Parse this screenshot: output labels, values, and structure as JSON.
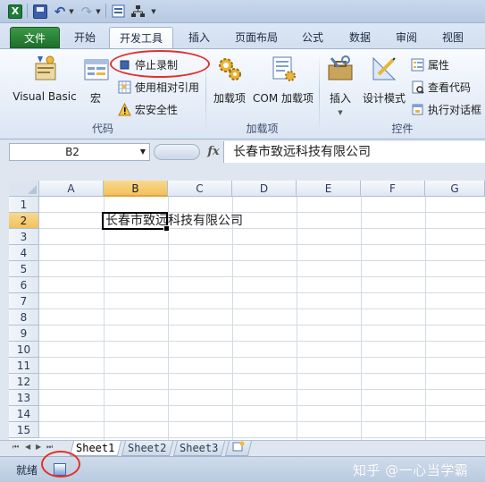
{
  "quick_access": {
    "app_icon": "excel-logo-icon",
    "app_icon_letter": "X",
    "items": [
      "save-icon",
      "undo-icon",
      "redo-icon",
      "form-icon",
      "tree-icon"
    ]
  },
  "tabs": [
    {
      "label": "文件",
      "state": "file"
    },
    {
      "label": "开始",
      "state": "normal"
    },
    {
      "label": "开发工具",
      "state": "active"
    },
    {
      "label": "插入",
      "state": "normal"
    },
    {
      "label": "页面布局",
      "state": "normal"
    },
    {
      "label": "公式",
      "state": "normal"
    },
    {
      "label": "数据",
      "state": "normal"
    },
    {
      "label": "审阅",
      "state": "normal"
    },
    {
      "label": "视图",
      "state": "normal"
    }
  ],
  "ribbon": {
    "code_group": {
      "label": "代码",
      "visual_basic": "Visual Basic",
      "macros": "宏",
      "stop_recording": "停止录制",
      "relative_ref": "使用相对引用",
      "macro_security": "宏安全性"
    },
    "addins_group": {
      "label": "加载项",
      "addins": "加载项",
      "com_addins": "COM 加载项"
    },
    "controls_group": {
      "label": "控件",
      "insert": "插入",
      "design_mode": "设计模式",
      "properties": "属性",
      "view_code": "查看代码",
      "run_dialog": "执行对话框"
    }
  },
  "formula_bar": {
    "name_box": "B2",
    "fx_label": "fx",
    "content": "长春市致远科技有限公司"
  },
  "grid": {
    "columns": [
      "A",
      "B",
      "C",
      "D",
      "E",
      "F",
      "G"
    ],
    "rows": [
      "1",
      "2",
      "3",
      "4",
      "5",
      "6",
      "7",
      "8",
      "9",
      "10",
      "11",
      "12",
      "13",
      "14",
      "15"
    ],
    "selected_cell": "B2",
    "b2_value": "长春市致远科技有限公司"
  },
  "sheets": [
    "Sheet1",
    "Sheet2",
    "Sheet3"
  ],
  "active_sheet": "Sheet1",
  "status": {
    "ready": "就绪"
  },
  "watermark": "知乎 @一心当学霸",
  "colors": {
    "accent_green": "#1e7a3a",
    "highlight_orange": "#f1c15f",
    "annotation_red": "#e1322c"
  }
}
